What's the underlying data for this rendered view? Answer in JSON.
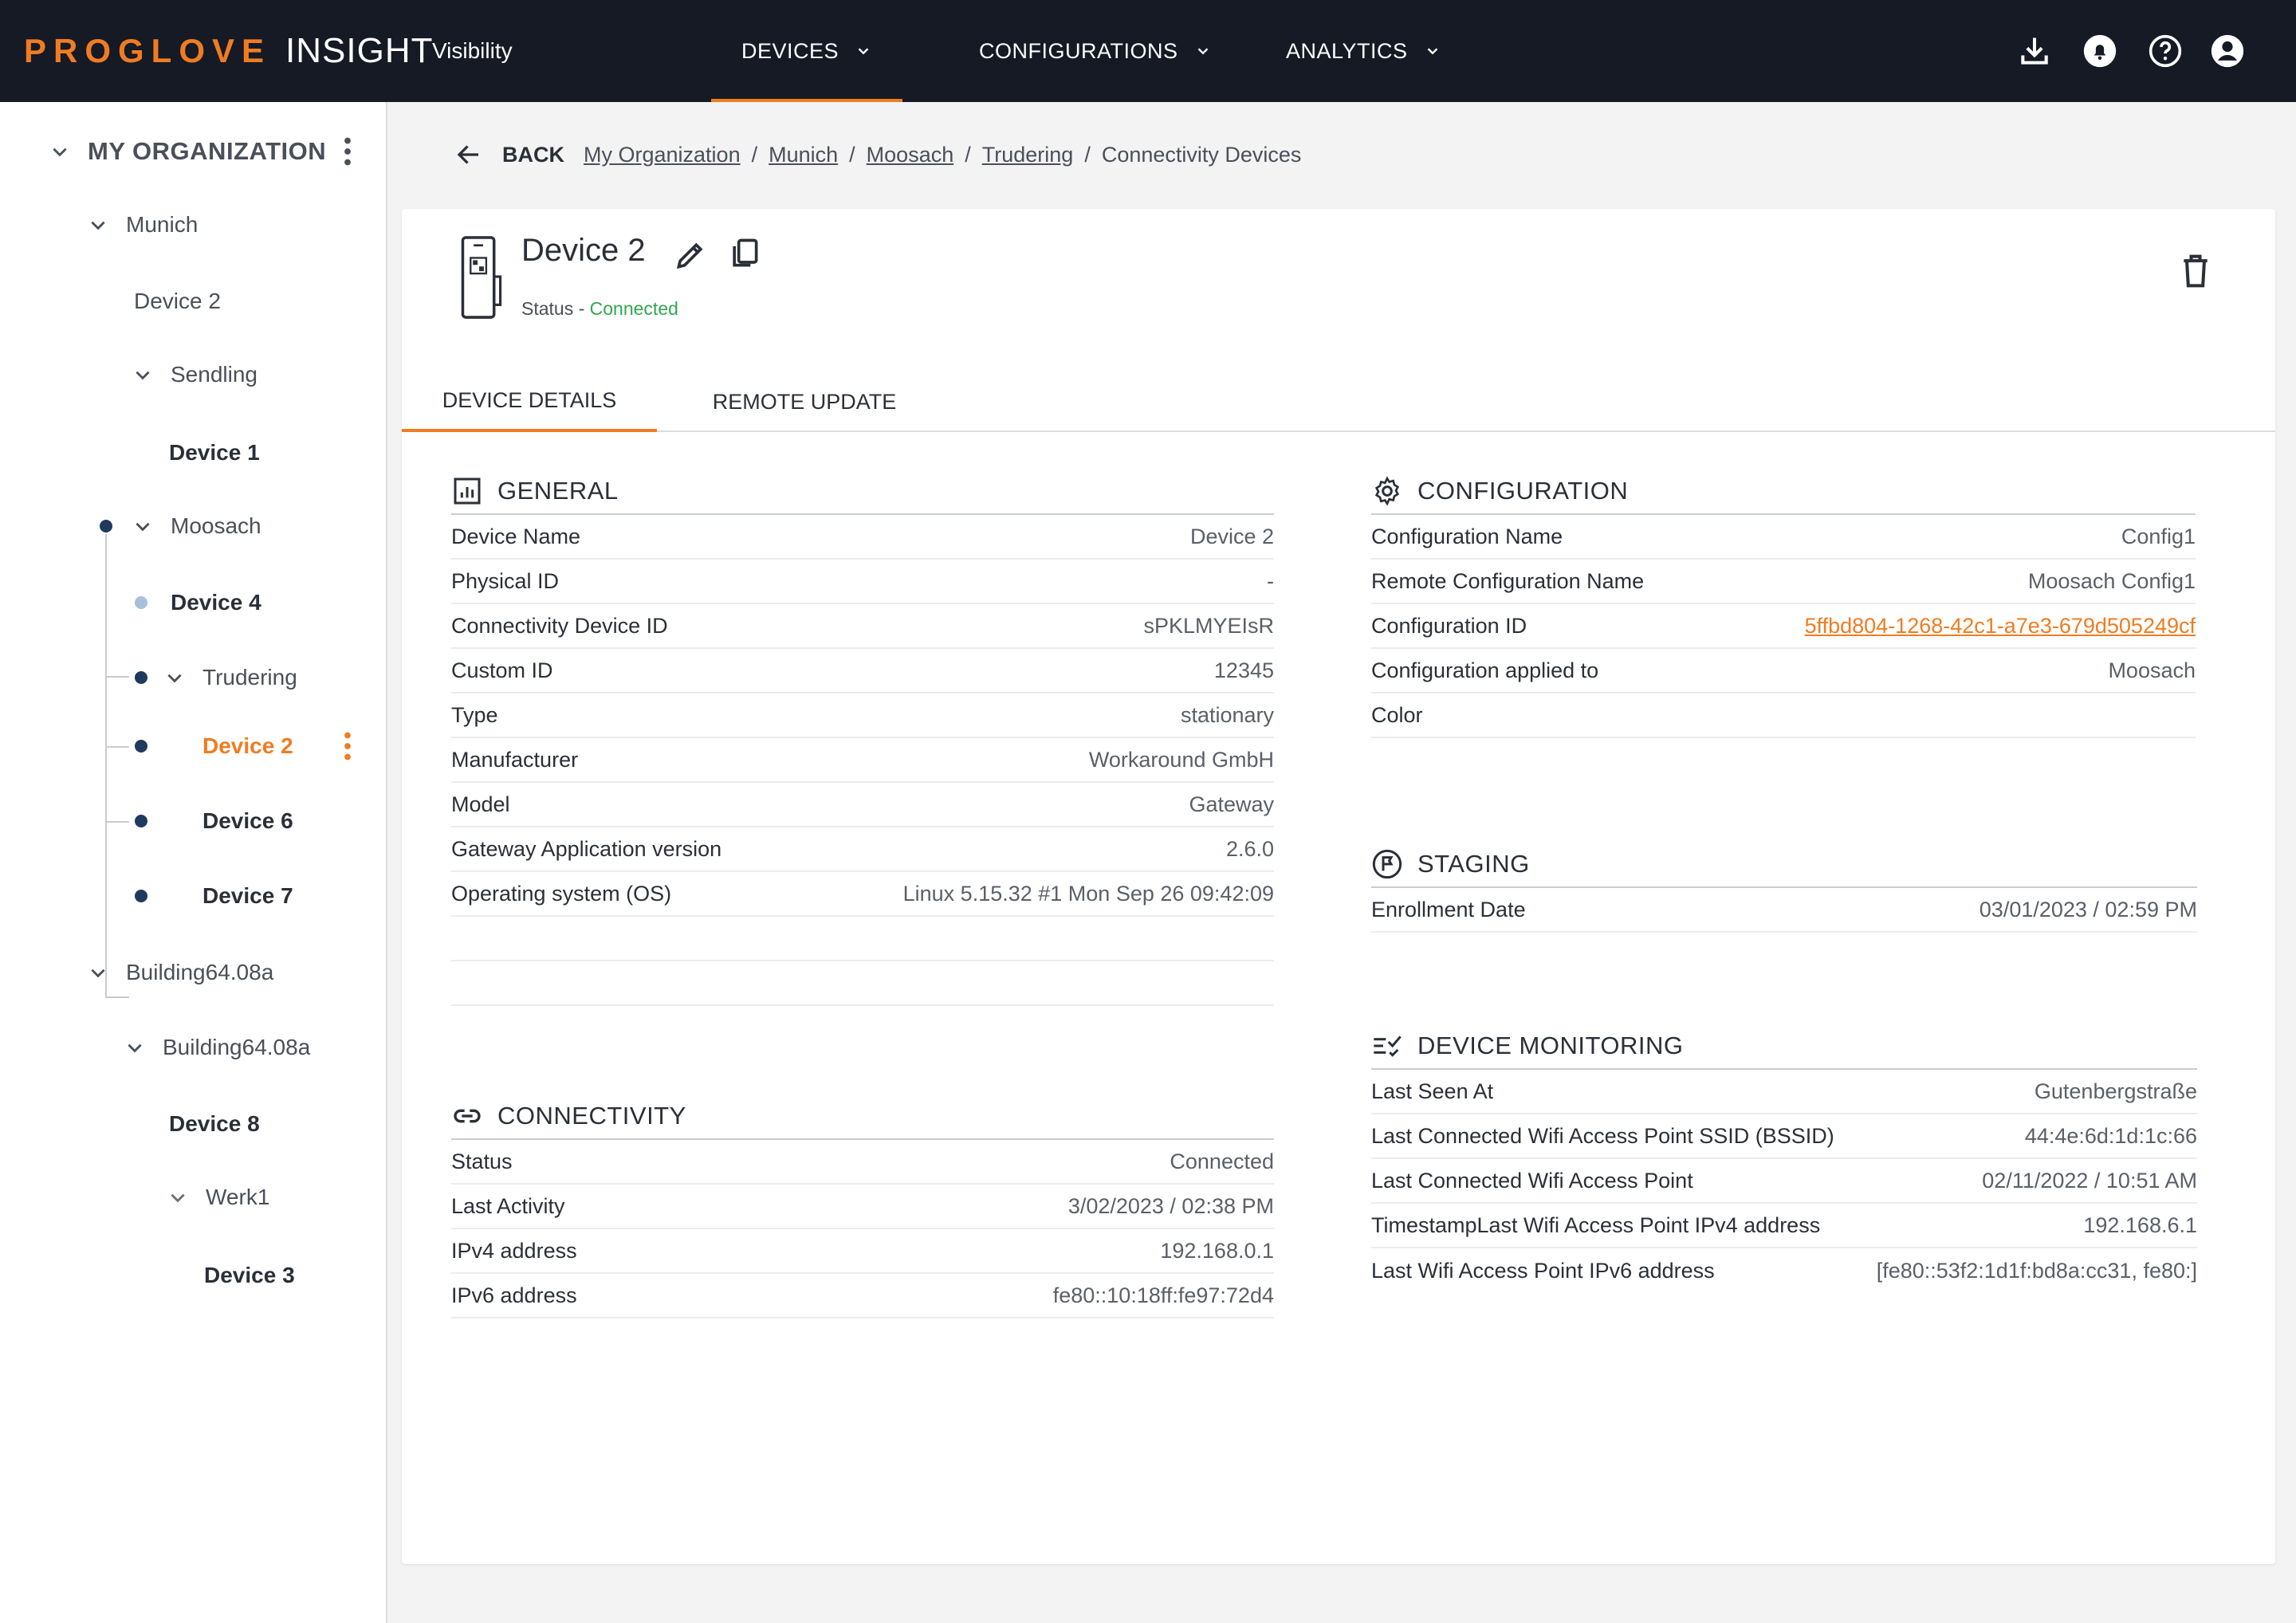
{
  "topbar": {
    "brand_primary": "PROGLOVE",
    "brand_secondary": "INSIGHT",
    "subtitle": "Visibility",
    "nav": [
      {
        "label": "DEVICES"
      },
      {
        "label": "CONFIGURATIONS"
      },
      {
        "label": "ANALYTICS"
      }
    ],
    "icons": [
      "download-icon",
      "bell-icon",
      "help-icon",
      "account-icon"
    ],
    "accent_color": "#f07c22",
    "bar_color": "#151a25"
  },
  "sidebar": {
    "title": "MY ORGANIZATION",
    "items": [
      {
        "label": "Munich"
      },
      {
        "label": "Device 2"
      },
      {
        "label": "Sendling"
      },
      {
        "label": "Device 1"
      },
      {
        "label": "Moosach"
      },
      {
        "label": "Device 4"
      },
      {
        "label": "Trudering"
      },
      {
        "label": "Device 2"
      },
      {
        "label": "Device 6"
      },
      {
        "label": "Device 7"
      },
      {
        "label": "Building64.08a"
      },
      {
        "label": "Building64.08a"
      },
      {
        "label": "Device 8"
      },
      {
        "label": "Werk1"
      },
      {
        "label": "Device 3"
      }
    ]
  },
  "breadcrumb": {
    "back": "BACK",
    "links": [
      "My Organization",
      "Munich",
      "Moosach",
      "Trudering"
    ],
    "current": "Connectivity Devices",
    "separator": "/"
  },
  "device": {
    "title": "Device 2",
    "status_label": "Status - ",
    "status_value": "Connected",
    "status_color": "#2fa84f"
  },
  "tabs": [
    {
      "label": "DEVICE DETAILS",
      "active": true
    },
    {
      "label": "REMOTE UPDATE",
      "active": false
    }
  ],
  "general": {
    "title": "GENERAL",
    "rows": [
      {
        "k": "Device Name",
        "v": "Device 2"
      },
      {
        "k": "Physical ID",
        "v": "-"
      },
      {
        "k": "Connectivity Device ID",
        "v": "sPKLMYEIsR"
      },
      {
        "k": "Custom ID",
        "v": "12345"
      },
      {
        "k": "Type",
        "v": "stationary"
      },
      {
        "k": "Manufacturer",
        "v": "Workaround GmbH"
      },
      {
        "k": "Model",
        "v": "Gateway"
      },
      {
        "k": "Gateway Application version",
        "v": "2.6.0"
      },
      {
        "k": "Operating system (OS)",
        "v": "Linux 5.15.32 #1 Mon Sep 26 09:42:09"
      }
    ]
  },
  "connectivity": {
    "title": "CONNECTIVITY",
    "rows": [
      {
        "k": "Status",
        "v": "Connected"
      },
      {
        "k": "Last Activity",
        "v": "3/02/2023 / 02:38 PM"
      },
      {
        "k": "IPv4 address",
        "v": "192.168.0.1"
      },
      {
        "k": "IPv6 address",
        "v": "fe80::10:18ff:fe97:72d4"
      }
    ]
  },
  "configuration": {
    "title": "CONFIGURATION",
    "rows": [
      {
        "k": "Configuration Name",
        "v": "Config1"
      },
      {
        "k": "Remote Configuration Name",
        "v": "Moosach Config1"
      },
      {
        "k": "Configuration ID",
        "v": "5ffbd804-1268-42c1-a7e3-679d505249cf"
      },
      {
        "k": "Configuration applied to",
        "v": "Moosach"
      },
      {
        "k": "Color",
        "v": ""
      }
    ]
  },
  "staging": {
    "title": "STAGING",
    "rows": [
      {
        "k": "Enrollment Date",
        "v": "03/01/2023 / 02:59 PM"
      }
    ]
  },
  "monitoring": {
    "title": "DEVICE MONITORING",
    "rows": [
      {
        "k": "Last Seen At",
        "v": "Gutenbergstraße"
      },
      {
        "k": "Last Connected Wifi Access Point SSID (BSSID)",
        "v": "44:4e:6d:1d:1c:66"
      },
      {
        "k": "Last Connected Wifi Access Point",
        "v": "02/11/2022 / 10:51 AM"
      },
      {
        "k": "TimestampLast Wifi Access Point IPv4 address",
        "v": "192.168.6.1"
      },
      {
        "k": "Last Wifi Access Point IPv6 address",
        "v": "[fe80::53f2:1d1f:bd8a:cc31, fe80:]"
      }
    ]
  }
}
